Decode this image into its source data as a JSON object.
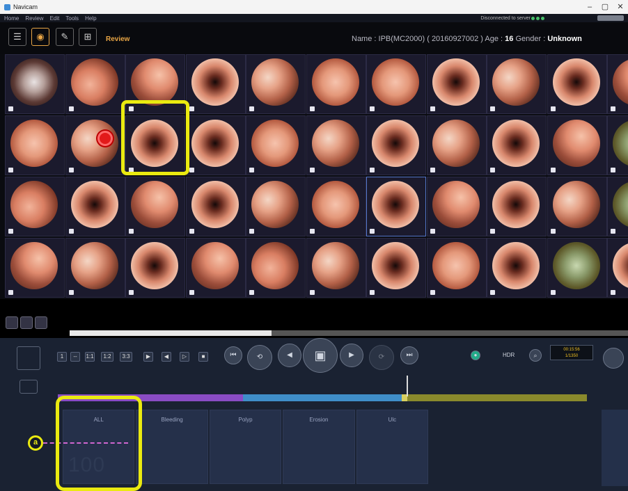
{
  "window": {
    "title": "Navicam",
    "controls": [
      "–",
      "▢",
      "✕"
    ]
  },
  "menu": {
    "items": [
      "Home",
      "Review",
      "Edit",
      "Tools",
      "Help"
    ],
    "connection_status": "Disconnected to server"
  },
  "toolbar": {
    "icons": [
      "grid-view-icon",
      "capsule-icon",
      "edit-icon",
      "car-icon"
    ],
    "mode_label": "Review"
  },
  "patient": {
    "name_label": "Name :",
    "name_value": "IPB(MC2000) ( 20160927002 )",
    "age_label": "Age :",
    "age_value": "16",
    "gender_label": "Gender :",
    "gender_value": "Unknown"
  },
  "playback": {
    "frame_box": [
      "1",
      "--",
      "1:1",
      "1:2",
      "3:3"
    ],
    "hdr_label": "HDR",
    "speed_text": [
      "00:15:56",
      "1/1350"
    ]
  },
  "timeline": {
    "segments": [
      {
        "color": "#8a4cc4",
        "fraction": 0.35
      },
      {
        "color": "#3f8ec8",
        "fraction": 0.3
      },
      {
        "color": "#d8d060",
        "fraction": 0.01
      },
      {
        "color": "#8a8a2c",
        "fraction": 0.34
      }
    ]
  },
  "tabs": [
    {
      "label": "ALL"
    },
    {
      "label": "Bleeding"
    },
    {
      "label": "Polyp"
    },
    {
      "label": "Erosion"
    },
    {
      "label": "Ulc"
    }
  ],
  "filter": {
    "annotation_marker": "a",
    "big_value": "100"
  }
}
